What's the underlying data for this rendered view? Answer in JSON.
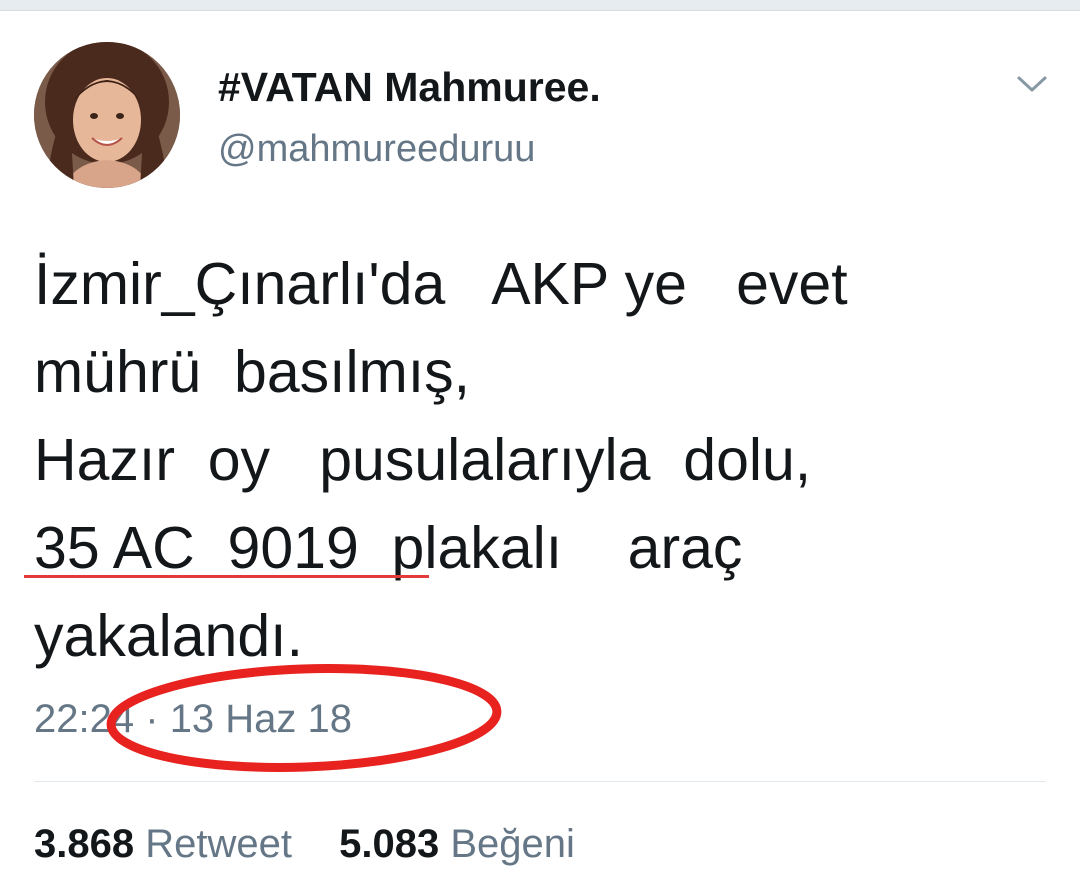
{
  "tweet": {
    "author": {
      "display_name": "#VATAN Mahmuree.",
      "handle": "@mahmureeduruu",
      "avatar_icon": "profile-photo"
    },
    "menu_icon": "chevron-down-icon",
    "text_lines": [
      "İzmir_Çınarlı'da   AKP ye   evet",
      "mührü  basılmış,",
      "Hazır  oy   pusulalarıyla  dolu,",
      "35 AC  9019  plakalı    araç",
      "yakalandı."
    ],
    "timestamp": {
      "time": "22:24",
      "separator": "·",
      "date": "13 Haz 18"
    },
    "stats": {
      "retweet_count": "3.868",
      "retweet_label": "Retweet",
      "like_count": "5.083",
      "like_label": "Beğeni"
    }
  },
  "annotations": {
    "underline_color": "#e33a3a",
    "circle_color": "#e8231f"
  },
  "colors": {
    "text_primary": "#14171a",
    "text_secondary": "#657786",
    "divider": "#e1e8ed"
  }
}
